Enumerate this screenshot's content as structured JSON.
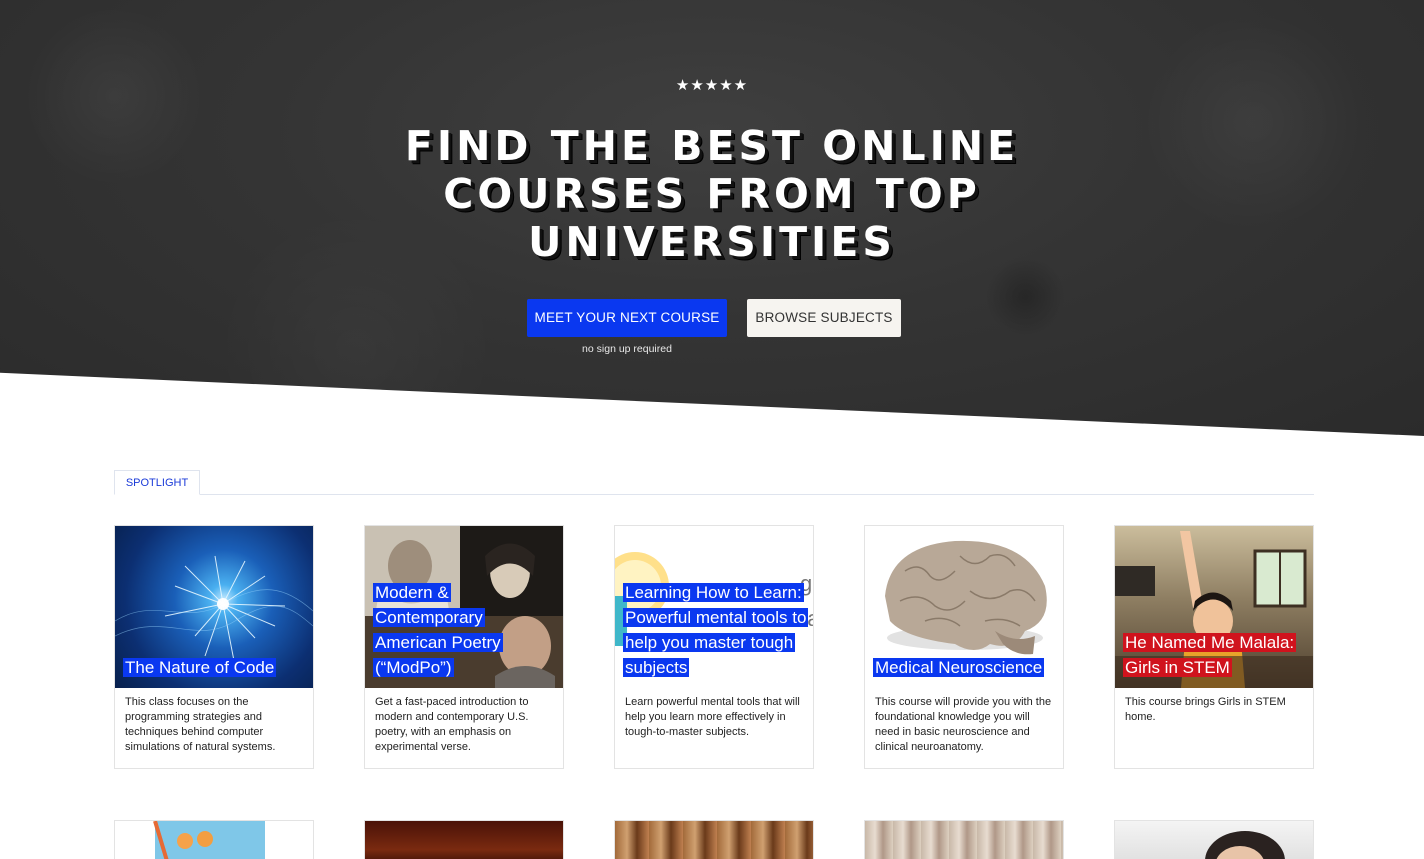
{
  "hero": {
    "stars": "★★★★★",
    "title": "FIND THE BEST ONLINE COURSES FROM TOP UNIVERSITIES",
    "primary_button": "MEET YOUR NEXT COURSE",
    "secondary_button": "BROWSE SUBJECTS",
    "note": "no sign up required"
  },
  "spotlight": {
    "tab_label": "SPOTLIGHT",
    "cards": [
      {
        "title": "The Nature of Code",
        "description": "This class focuses on the programming strategies and techniques behind computer simulations of natural systems.",
        "label_color": "#0a38f0"
      },
      {
        "title": "Modern & Contemporary American Poetry (“ModPo”)",
        "description": "Get a fast-paced introduction to modern and contemporary U.S. poetry, with an emphasis on experimental verse.",
        "label_color": "#0a38f0"
      },
      {
        "title": "Learning How to Learn: Powerful mental tools to help you master tough subjects",
        "description": "Learn powerful mental tools that will help you learn more effectively in tough-to-master subjects.",
        "label_color": "#0a38f0"
      },
      {
        "title": "Medical Neuroscience",
        "description": "This course will provide you with the foundational knowledge you will need in basic neuroscience and clinical neuroanatomy.",
        "label_color": "#0a38f0"
      },
      {
        "title": "He Named Me Malala: Girls in STEM",
        "description": "This course brings Girls in STEM home.",
        "label_color": "#d0131d"
      }
    ]
  },
  "colors": {
    "accent": "#0a38f0",
    "alert": "#d0131d",
    "hero_bg": "#343434"
  }
}
